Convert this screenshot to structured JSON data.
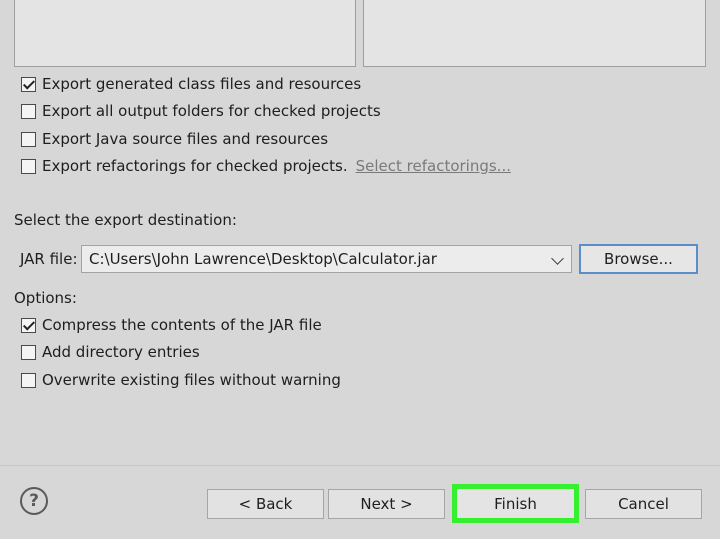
{
  "export_options": [
    {
      "label": "Export generated class files and resources",
      "checked": true
    },
    {
      "label": "Export all output folders for checked projects",
      "checked": false
    },
    {
      "label": "Export Java source files and resources",
      "checked": false
    },
    {
      "label": "Export refactorings for checked projects.",
      "checked": false
    }
  ],
  "select_refactorings_link": "Select refactorings...",
  "destination": {
    "heading": "Select the export destination:",
    "jar_label": "JAR file:",
    "jar_path": "C:\\Users\\John Lawrence\\Desktop\\Calculator.jar",
    "browse_label": "Browse..."
  },
  "options": {
    "heading": "Options:",
    "items": [
      {
        "label": "Compress the contents of the JAR file",
        "checked": true
      },
      {
        "label": "Add directory entries",
        "checked": false
      },
      {
        "label": "Overwrite existing files without warning",
        "checked": false
      }
    ]
  },
  "footer": {
    "help_glyph": "?",
    "back_label": "< Back",
    "next_label": "Next >",
    "finish_label": "Finish",
    "cancel_label": "Cancel",
    "finish_highlight_color": "#35f02f"
  }
}
